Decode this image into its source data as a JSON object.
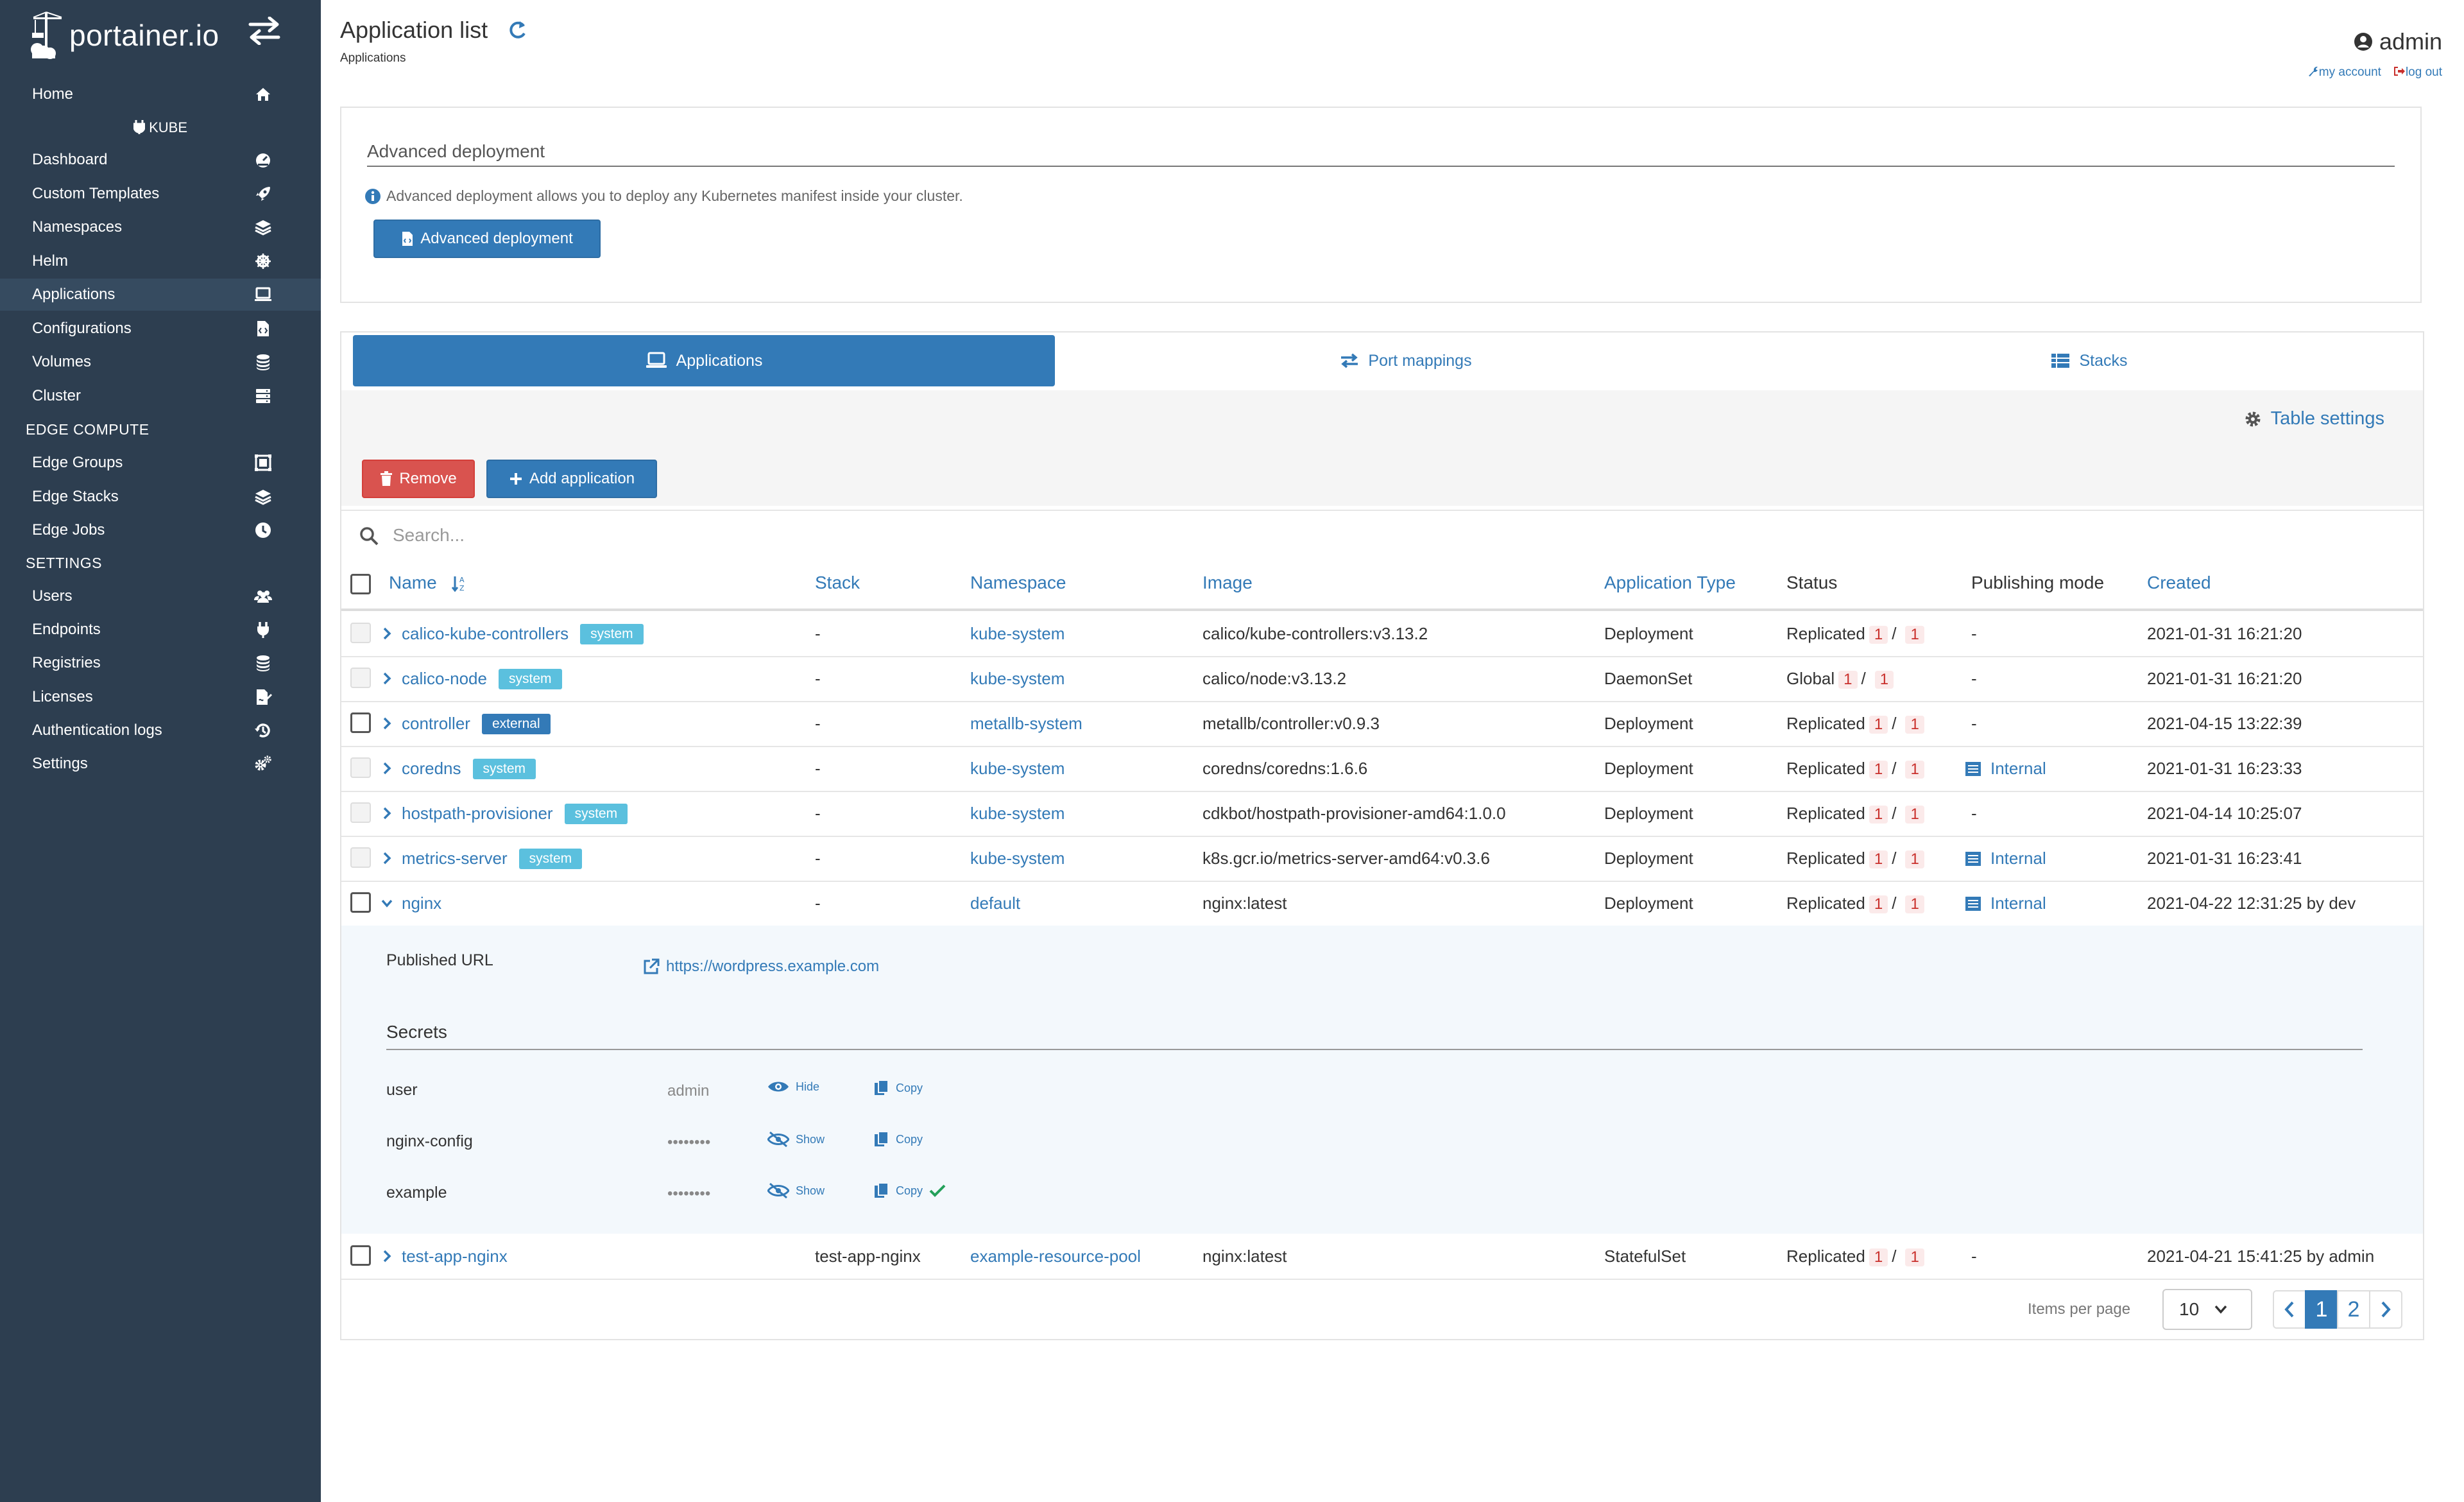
{
  "brand": {
    "logo_text": "portainer.io"
  },
  "sidebar": {
    "home": "Home",
    "env_title": "KUBE",
    "kube_items": [
      {
        "label": "Dashboard",
        "icon": "dashboard-icon"
      },
      {
        "label": "Custom Templates",
        "icon": "rocket-icon"
      },
      {
        "label": "Namespaces",
        "icon": "layers-icon"
      },
      {
        "label": "Helm",
        "icon": "helm-icon"
      },
      {
        "label": "Applications",
        "icon": "laptop-icon",
        "active": true
      },
      {
        "label": "Configurations",
        "icon": "file-code-icon"
      },
      {
        "label": "Volumes",
        "icon": "database-icon"
      },
      {
        "label": "Cluster",
        "icon": "server-icon"
      }
    ],
    "edge_title": "EDGE COMPUTE",
    "edge_items": [
      {
        "label": "Edge Groups",
        "icon": "object-group-icon"
      },
      {
        "label": "Edge Stacks",
        "icon": "layers-icon"
      },
      {
        "label": "Edge Jobs",
        "icon": "clock-icon"
      }
    ],
    "settings_title": "SETTINGS",
    "settings_items": [
      {
        "label": "Users",
        "icon": "users-icon"
      },
      {
        "label": "Endpoints",
        "icon": "plug-icon"
      },
      {
        "label": "Registries",
        "icon": "database-icon"
      },
      {
        "label": "Licenses",
        "icon": "file-signature-icon"
      },
      {
        "label": "Authentication logs",
        "icon": "history-icon"
      },
      {
        "label": "Settings",
        "icon": "cogs-icon"
      }
    ]
  },
  "header": {
    "title": "Application list",
    "breadcrumb": "Applications",
    "user": "admin",
    "my_account": "my account",
    "log_out": "log out"
  },
  "advanced": {
    "title": "Advanced deployment",
    "info": "Advanced deployment allows you to deploy any Kubernetes manifest inside your cluster.",
    "button": "Advanced deployment"
  },
  "tabs": {
    "applications": "Applications",
    "port_mappings": "Port mappings",
    "stacks": "Stacks"
  },
  "toolbar": {
    "table_settings": "Table settings",
    "remove": "Remove",
    "add_application": "Add application",
    "search_placeholder": "Search..."
  },
  "columns": {
    "name": "Name",
    "stack": "Stack",
    "namespace": "Namespace",
    "image": "Image",
    "type": "Application Type",
    "status": "Status",
    "publishing": "Publishing mode",
    "created": "Created"
  },
  "rows": [
    {
      "name": "calico-kube-controllers",
      "badge": "system",
      "stack": "-",
      "namespace": "kube-system",
      "image": "calico/kube-controllers:v3.13.2",
      "type": "Deployment",
      "status": "Replicated",
      "running": "1",
      "total": "1",
      "publishing": "-",
      "created": "2021-01-31 16:21:20"
    },
    {
      "name": "calico-node",
      "badge": "system",
      "stack": "-",
      "namespace": "kube-system",
      "image": "calico/node:v3.13.2",
      "type": "DaemonSet",
      "status": "Global",
      "running": "1",
      "total": "1",
      "publishing": "-",
      "created": "2021-01-31 16:21:20"
    },
    {
      "name": "controller",
      "badge": "external",
      "stack": "-",
      "namespace": "metallb-system",
      "image": "metallb/controller:v0.9.3",
      "type": "Deployment",
      "status": "Replicated",
      "running": "1",
      "total": "1",
      "publishing": "-",
      "created": "2021-04-15 13:22:39"
    },
    {
      "name": "coredns",
      "badge": "system",
      "stack": "-",
      "namespace": "kube-system",
      "image": "coredns/coredns:1.6.6",
      "type": "Deployment",
      "status": "Replicated",
      "running": "1",
      "total": "1",
      "publishing": "Internal",
      "created": "2021-01-31 16:23:33"
    },
    {
      "name": "hostpath-provisioner",
      "badge": "system",
      "stack": "-",
      "namespace": "kube-system",
      "image": "cdkbot/hostpath-provisioner-amd64:1.0.0",
      "type": "Deployment",
      "status": "Replicated",
      "running": "1",
      "total": "1",
      "publishing": "-",
      "created": "2021-04-14 10:25:07"
    },
    {
      "name": "metrics-server",
      "badge": "system",
      "stack": "-",
      "namespace": "kube-system",
      "image": "k8s.gcr.io/metrics-server-amd64:v0.3.6",
      "type": "Deployment",
      "status": "Replicated",
      "running": "1",
      "total": "1",
      "publishing": "Internal",
      "created": "2021-01-31 16:23:41"
    },
    {
      "name": "nginx",
      "badge": "",
      "stack": "-",
      "namespace": "default",
      "image": "nginx:latest",
      "type": "Deployment",
      "status": "Replicated",
      "running": "1",
      "total": "1",
      "publishing": "Internal",
      "created": "2021-04-22 12:31:25 by dev"
    }
  ],
  "detail": {
    "published_url_label": "Published URL",
    "published_url": "https://wordpress.example.com",
    "secrets_title": "Secrets",
    "secrets": [
      {
        "key": "user",
        "value": "admin",
        "toggle": "Hide",
        "copy": "Copy",
        "copied": false
      },
      {
        "key": "nginx-config",
        "value": "••••••••",
        "toggle": "Show",
        "copy": "Copy",
        "copied": false
      },
      {
        "key": "example",
        "value": "••••••••",
        "toggle": "Show",
        "copy": "Copy",
        "copied": true
      }
    ]
  },
  "last_row": {
    "name": "test-app-nginx",
    "stack": "test-app-nginx",
    "namespace": "example-resource-pool",
    "image": "nginx:latest",
    "type": "StatefulSet",
    "status": "Replicated",
    "running": "1",
    "total": "1",
    "publishing": "-",
    "created": "2021-04-21 15:41:25 by admin"
  },
  "pagination": {
    "items_per_page_label": "Items per page",
    "items_per_page": "10",
    "pages": [
      "1",
      "2"
    ],
    "current": "1"
  },
  "colors": {
    "sidebar_bg": "#2d3e50",
    "primary": "#337ab7",
    "danger": "#d9534f",
    "info_badge": "#5bc0de",
    "detail_bg": "#f3f8fc"
  }
}
